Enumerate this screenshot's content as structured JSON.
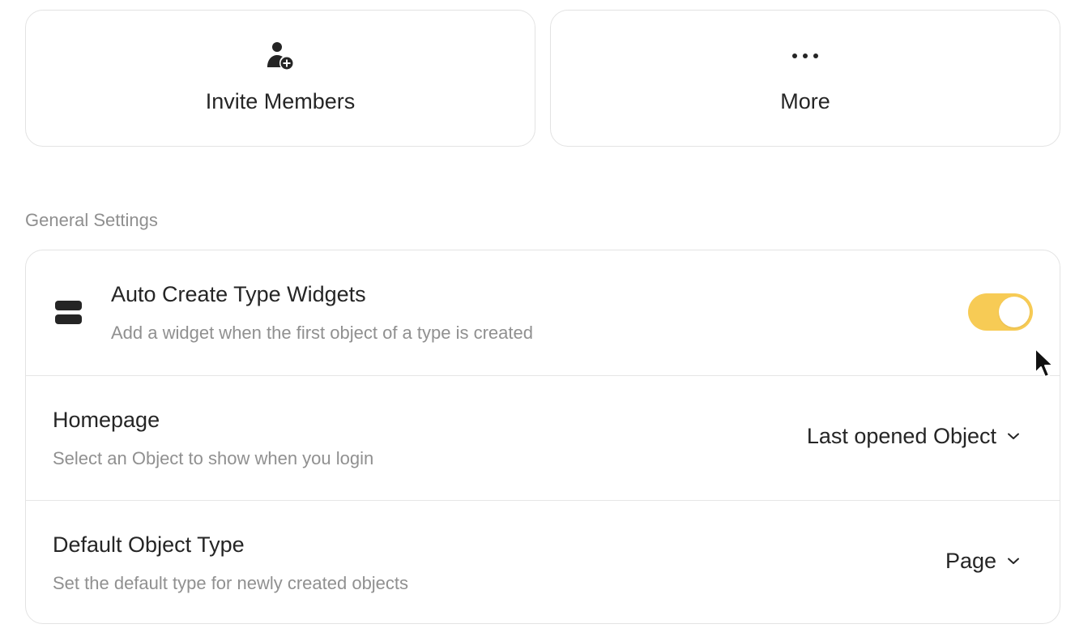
{
  "actions": [
    {
      "label": "Invite Members",
      "icon": "user-plus-icon"
    },
    {
      "label": "More",
      "icon": "more-horizontal-icon"
    }
  ],
  "section_title": "General Settings",
  "settings": {
    "auto_create": {
      "title": "Auto Create Type Widgets",
      "description": "Add a widget when the first object of a type is created",
      "icon": "widget-icon",
      "enabled": true
    },
    "homepage": {
      "title": "Homepage",
      "description": "Select an Object to show when you login",
      "value": "Last opened Object"
    },
    "default_type": {
      "title": "Default Object Type",
      "description": "Set the default type for newly created objects",
      "value": "Page"
    }
  },
  "colors": {
    "toggle_on": "#f7cb55",
    "border": "#e3e3e3",
    "text_primary": "#252525",
    "text_secondary": "#909090"
  }
}
